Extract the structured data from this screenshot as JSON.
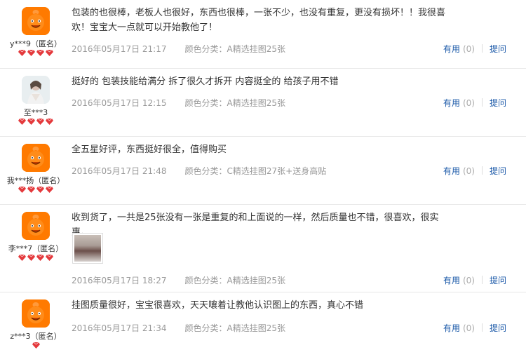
{
  "colors": {
    "link": "#1a58a8",
    "meta": "#999999",
    "text": "#333333",
    "avatar_bg": "#ff7a00",
    "gem": "#e4393c"
  },
  "reviews": [
    {
      "username": "y***9（匿名）",
      "avatar_icon": "anonymous-orange-avatar-icon",
      "rank_gems": 4,
      "content": "包装的也很棒，老板人也很好，东西也很棒，一张不少，也没有重复，更没有损坏！！我很喜欢！宝宝大一点就可以开始教他了！",
      "date": "2016年05月17日 21:17",
      "sku": "颜色分类：A精选挂图25张",
      "useful_label": "有用",
      "useful_count": "(0)",
      "ask_label": "提问"
    },
    {
      "username": "至***3",
      "avatar_icon": "user-photo-avatar-icon",
      "rank_gems": 4,
      "content": "挺好的 包装技能给满分 拆了很久才拆开 内容挺全的 给孩子用不错",
      "date": "2016年05月17日 12:15",
      "sku": "颜色分类：A精选挂图25张",
      "useful_label": "有用",
      "useful_count": "(0)",
      "ask_label": "提问"
    },
    {
      "username": "我***扬（匿名）",
      "avatar_icon": "anonymous-orange-avatar-icon",
      "rank_gems": 4,
      "content": "全五星好评，东西挺好很全，值得购买",
      "date": "2016年05月17日 21:48",
      "sku": "颜色分类：C精选挂图27张+送身高贴",
      "useful_label": "有用",
      "useful_count": "(0)",
      "ask_label": "提问"
    },
    {
      "username": "李***7（匿名）",
      "avatar_icon": "anonymous-orange-avatar-icon",
      "rank_gems": 4,
      "content": "收到货了，一共是25张没有一张是重复的和上面说的一样，然后质量也不错，很喜欢，很实惠。",
      "date": "2016年05月17日 18:27",
      "sku": "颜色分类：A精选挂图25张",
      "useful_label": "有用",
      "useful_count": "(0)",
      "ask_label": "提问"
    },
    {
      "username": "z***3（匿名）",
      "avatar_icon": "anonymous-orange-avatar-icon",
      "rank_gems": 1,
      "content": "挂图质量很好，宝宝很喜欢，天天嚷着让教他认识图上的东西，真心不错",
      "date": "2016年05月17日 21:34",
      "sku": "颜色分类：A精选挂图25张",
      "useful_label": "有用",
      "useful_count": "(0)",
      "ask_label": "提问"
    }
  ]
}
